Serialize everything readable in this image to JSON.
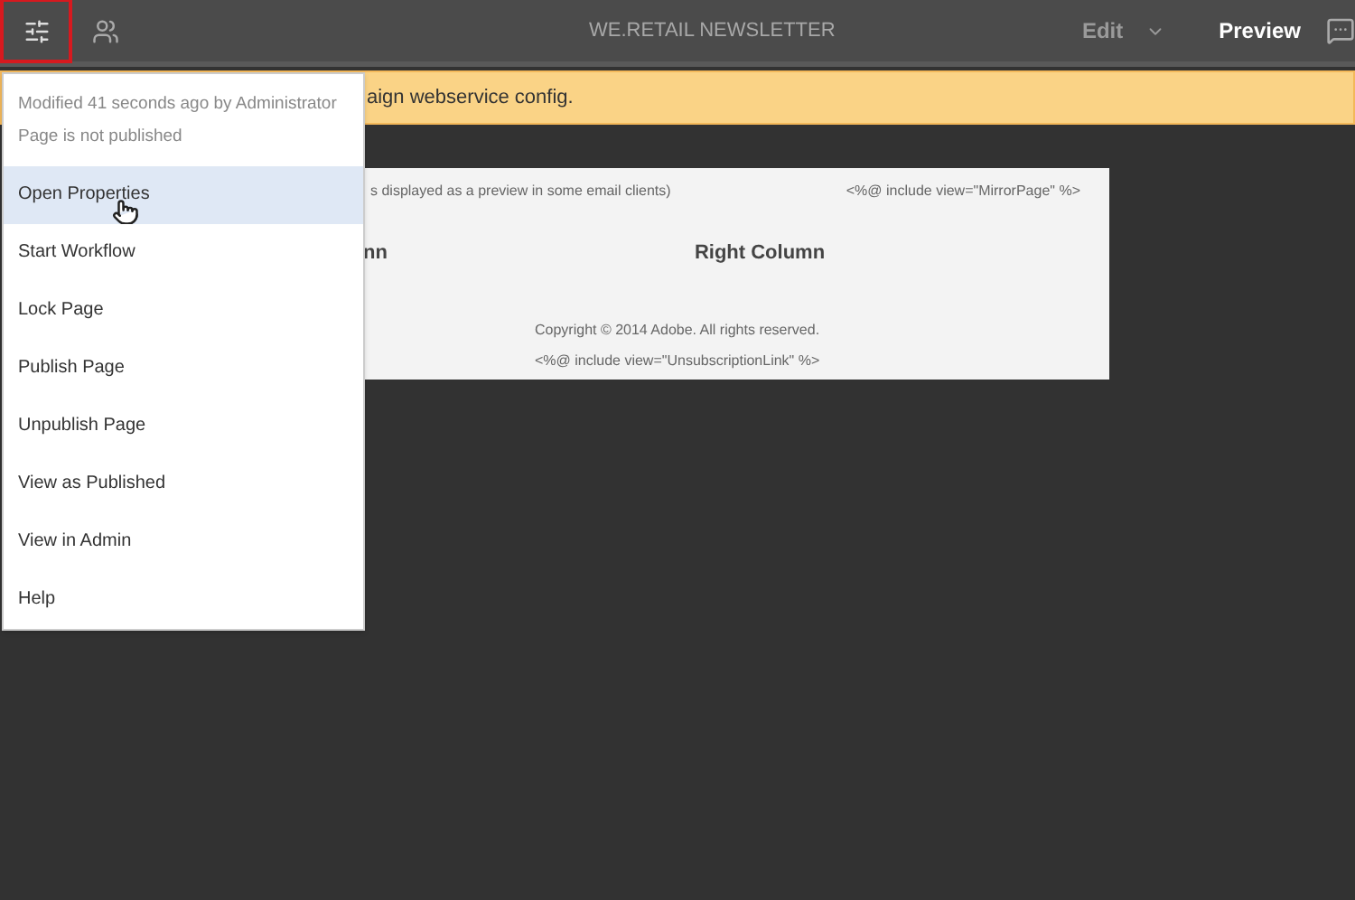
{
  "topbar": {
    "title": "WE.RETAIL NEWSLETTER",
    "mode": "Edit",
    "preview": "Preview",
    "page_info_open": true
  },
  "alert": {
    "text": "aign webservice config."
  },
  "page": {
    "mirror_note": "s displayed as a preview in some email clients)",
    "mirror_include": "<%@ include view=\"MirrorPage\" %>",
    "left_column": "nn",
    "right_column": "Right Column",
    "copyright": "Copyright © 2014 Adobe. All rights reserved.",
    "unsub_include": "<%@ include view=\"UnsubscriptionLink\" %>"
  },
  "menu": {
    "status": [
      "Modified 41 seconds ago by Administrator",
      "Page is not published"
    ],
    "items": [
      {
        "label": "Open Properties",
        "selected": true
      },
      {
        "label": "Start Workflow",
        "selected": false
      },
      {
        "label": "Lock Page",
        "selected": false
      },
      {
        "label": "Publish Page",
        "selected": false
      },
      {
        "label": "Unpublish Page",
        "selected": false
      },
      {
        "label": "View as Published",
        "selected": false
      },
      {
        "label": "View in Admin",
        "selected": false
      },
      {
        "label": "Help",
        "selected": false
      }
    ]
  }
}
